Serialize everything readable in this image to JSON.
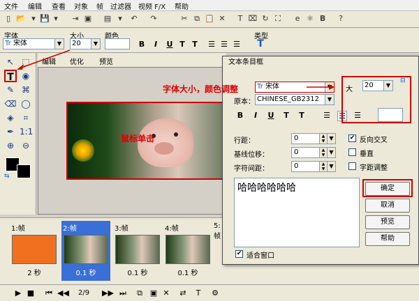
{
  "menu": [
    "文件",
    "编辑",
    "查看",
    "对象",
    "帧",
    "过滤器",
    "视频 F/X",
    "帮助"
  ],
  "toolbar1": {
    "icons": [
      "new-icon",
      "open-icon",
      "save-icon",
      "import-icon",
      "export-icon",
      "frame-icon",
      "undo-icon",
      "redo-icon",
      "cut-icon",
      "copy-icon",
      "paste-icon",
      "delete-icon",
      "ie-icon",
      "bold-icon",
      "help-icon"
    ]
  },
  "format": {
    "font_label": "字体",
    "font_value": "宋体",
    "font_prefix": "Tr",
    "size_label": "大小",
    "size_value": "20",
    "color_label": "颜色",
    "type_label": "类型",
    "bold": "B",
    "italic": "I",
    "underline": "U",
    "t1": "T",
    "t2": "T"
  },
  "tabs": [
    "编辑",
    "优化",
    "预览"
  ],
  "annotations": {
    "click": "鼠标单击",
    "font_size_color": "字体大小，颜色调整"
  },
  "frames": [
    {
      "label": "1:帧",
      "duration": "2 秒"
    },
    {
      "label": "2:帧",
      "duration": "0.1 秒",
      "selected": true
    },
    {
      "label": "3:帧",
      "duration": "0.1 秒"
    },
    {
      "label": "4:帧",
      "duration": "0.1 秒"
    },
    {
      "label": "5:帧",
      "duration": ""
    }
  ],
  "status": {
    "page": "2/9"
  },
  "dialog": {
    "title": "文本条目框",
    "font_value": "宋体",
    "font_prefix": "Tr",
    "script_label": "原本：",
    "script_value": "CHINESE_GB2312",
    "size_label": "大",
    "size_value": "20",
    "line_label": "行距：",
    "line_value": "0",
    "baseline_label": "基线位移：",
    "baseline_value": "0",
    "charspace_label": "字符间距：",
    "charspace_value": "0",
    "antialias_label": "反向交叉",
    "vertical_label": "垂直",
    "kerning_label": "字距调整",
    "text_value": "哈哈哈哈哈哈",
    "ok": "确定",
    "cancel": "取消",
    "preview": "预览",
    "help": "帮助",
    "fit_label": "适合窗口"
  },
  "colors": {
    "accent_red": "#d00000",
    "selection": "#3a6fd8"
  }
}
